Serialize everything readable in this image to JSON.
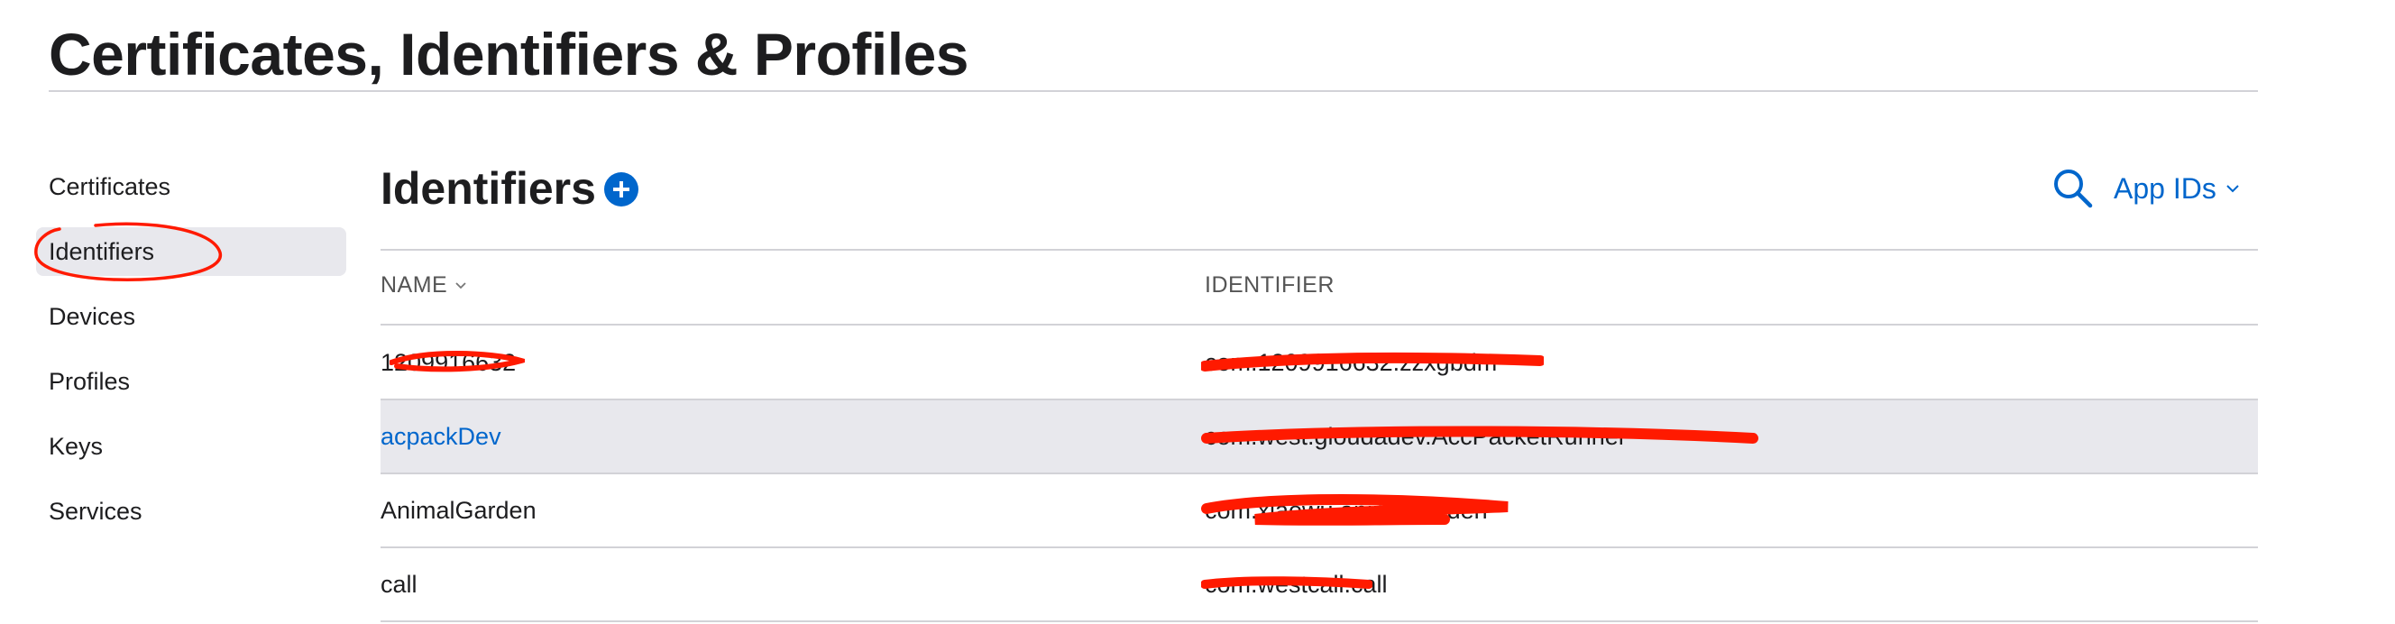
{
  "page": {
    "title": "Certificates, Identifiers & Profiles"
  },
  "sidebar": {
    "items": [
      {
        "label": "Certificates"
      },
      {
        "label": "Identifiers",
        "active": true
      },
      {
        "label": "Devices"
      },
      {
        "label": "Profiles"
      },
      {
        "label": "Keys"
      },
      {
        "label": "Services"
      }
    ]
  },
  "main": {
    "section_title": "Identifiers",
    "filter_label": "App IDs",
    "table": {
      "headers": {
        "name": "NAME",
        "identifier": "IDENTIFIER"
      },
      "rows": [
        {
          "name": "1209916632",
          "identifier": "com.1209916632.zzxgbdm"
        },
        {
          "name": "acpackDev",
          "identifier": "com.west.gloudadev.AccPacketRunner"
        },
        {
          "name": "AnimalGarden",
          "identifier": "com.xiaowu.animalgarden"
        },
        {
          "name": "call",
          "identifier": "com.westcall.call"
        }
      ]
    }
  },
  "colors": {
    "accent": "#0066cc",
    "annotation": "#ff1a00",
    "row_highlight": "#e8e8ed"
  }
}
